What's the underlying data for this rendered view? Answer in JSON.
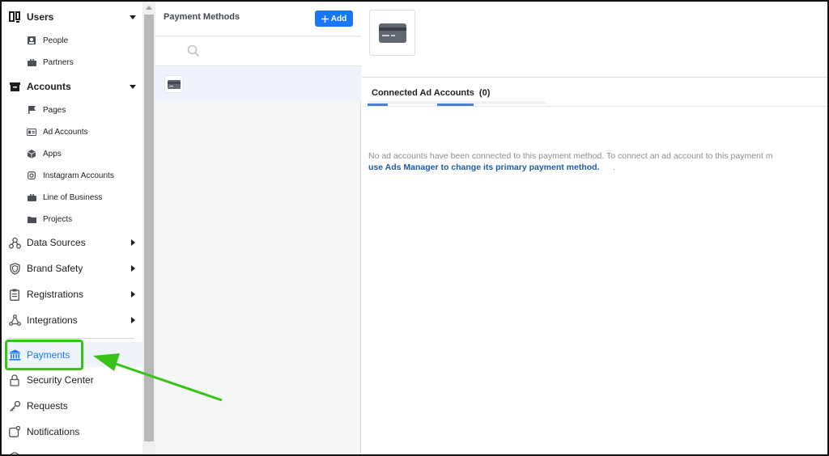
{
  "sidebar": {
    "users": {
      "label": "Users",
      "icon": "users-icon"
    },
    "people": {
      "label": "People"
    },
    "partners": {
      "label": "Partners"
    },
    "accounts": {
      "label": "Accounts"
    },
    "pages": {
      "label": "Pages"
    },
    "ad_accounts": {
      "label": "Ad Accounts"
    },
    "apps": {
      "label": "Apps"
    },
    "instagram": {
      "label": "Instagram Accounts"
    },
    "line_of_business": {
      "label": "Line of Business"
    },
    "projects": {
      "label": "Projects"
    },
    "data_sources": {
      "label": "Data Sources"
    },
    "brand_safety": {
      "label": "Brand Safety"
    },
    "registrations": {
      "label": "Registrations"
    },
    "integrations": {
      "label": "Integrations"
    },
    "payments": {
      "label": "Payments"
    },
    "security_center": {
      "label": "Security Center"
    },
    "requests": {
      "label": "Requests"
    },
    "notifications": {
      "label": "Notifications"
    }
  },
  "middle": {
    "title": "Payment Methods",
    "add_label": "Add",
    "search_placeholder": ""
  },
  "right": {
    "tab_label": "Connected Ad Accounts",
    "tab_count": "(0)",
    "empty_message": "No ad accounts have been connected to this payment method. To connect an ad account to this payment m",
    "empty_link": "use Ads Manager to change its primary payment method.",
    "empty_suffix": "."
  },
  "colors": {
    "accent": "#1877f2",
    "highlight": "#38c316",
    "link": "#1d5ca8"
  }
}
